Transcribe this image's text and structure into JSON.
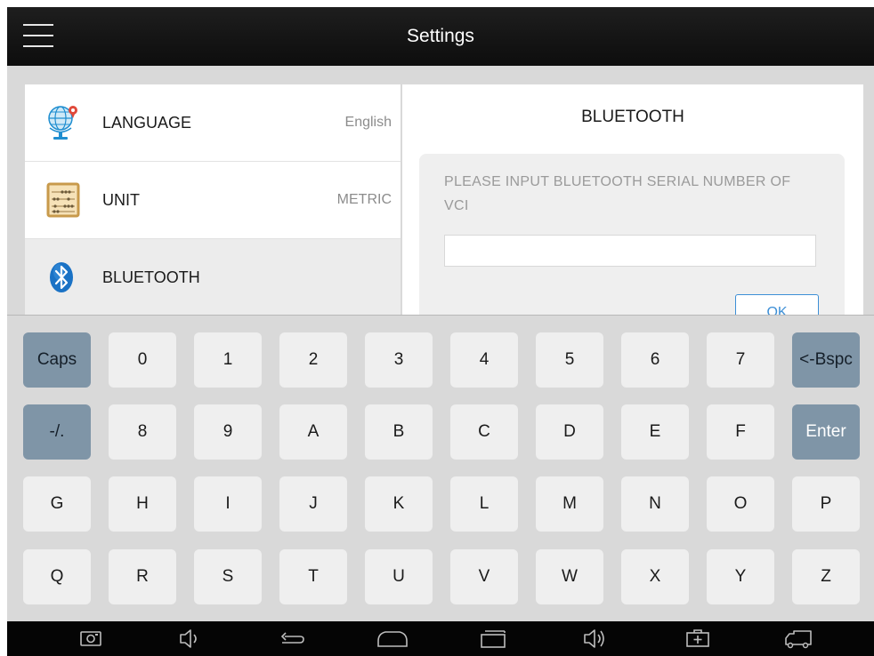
{
  "header": {
    "title": "Settings",
    "menu_icon": "hamburger-menu-icon"
  },
  "settings_list": [
    {
      "label": "LANGUAGE",
      "value": "English",
      "icon": "globe-location-icon",
      "selected": false
    },
    {
      "label": "UNIT",
      "value": "METRIC",
      "icon": "abacus-icon",
      "selected": false
    },
    {
      "label": "BLUETOOTH",
      "value": "",
      "icon": "bluetooth-icon",
      "selected": true
    }
  ],
  "bluetooth_panel": {
    "title": "BLUETOOTH",
    "instruction": "PLEASE INPUT BLUETOOTH SERIAL NUMBER OF VCI",
    "input_value": "",
    "ok_label": "OK"
  },
  "keyboard": {
    "rows": [
      [
        "Caps",
        "0",
        "1",
        "2",
        "3",
        "4",
        "5",
        "6",
        "7",
        "<-Bspc"
      ],
      [
        "-/.",
        "8",
        "9",
        "A",
        "B",
        "C",
        "D",
        "E",
        "F",
        "Enter"
      ],
      [
        "G",
        "H",
        "I",
        "J",
        "K",
        "L",
        "M",
        "N",
        "O",
        "P"
      ],
      [
        "Q",
        "R",
        "S",
        "T",
        "U",
        "V",
        "W",
        "X",
        "Y",
        "Z"
      ]
    ]
  },
  "navbar": {
    "icons": [
      "screenshot-icon",
      "volume-down-icon",
      "back-icon",
      "home-icon",
      "recent-apps-icon",
      "volume-up-icon",
      "medical-kit-icon",
      "truck-icon"
    ]
  },
  "colors": {
    "accent": "#3d8fd6",
    "special_key": "#7f95a7",
    "topbar": "#121212"
  }
}
